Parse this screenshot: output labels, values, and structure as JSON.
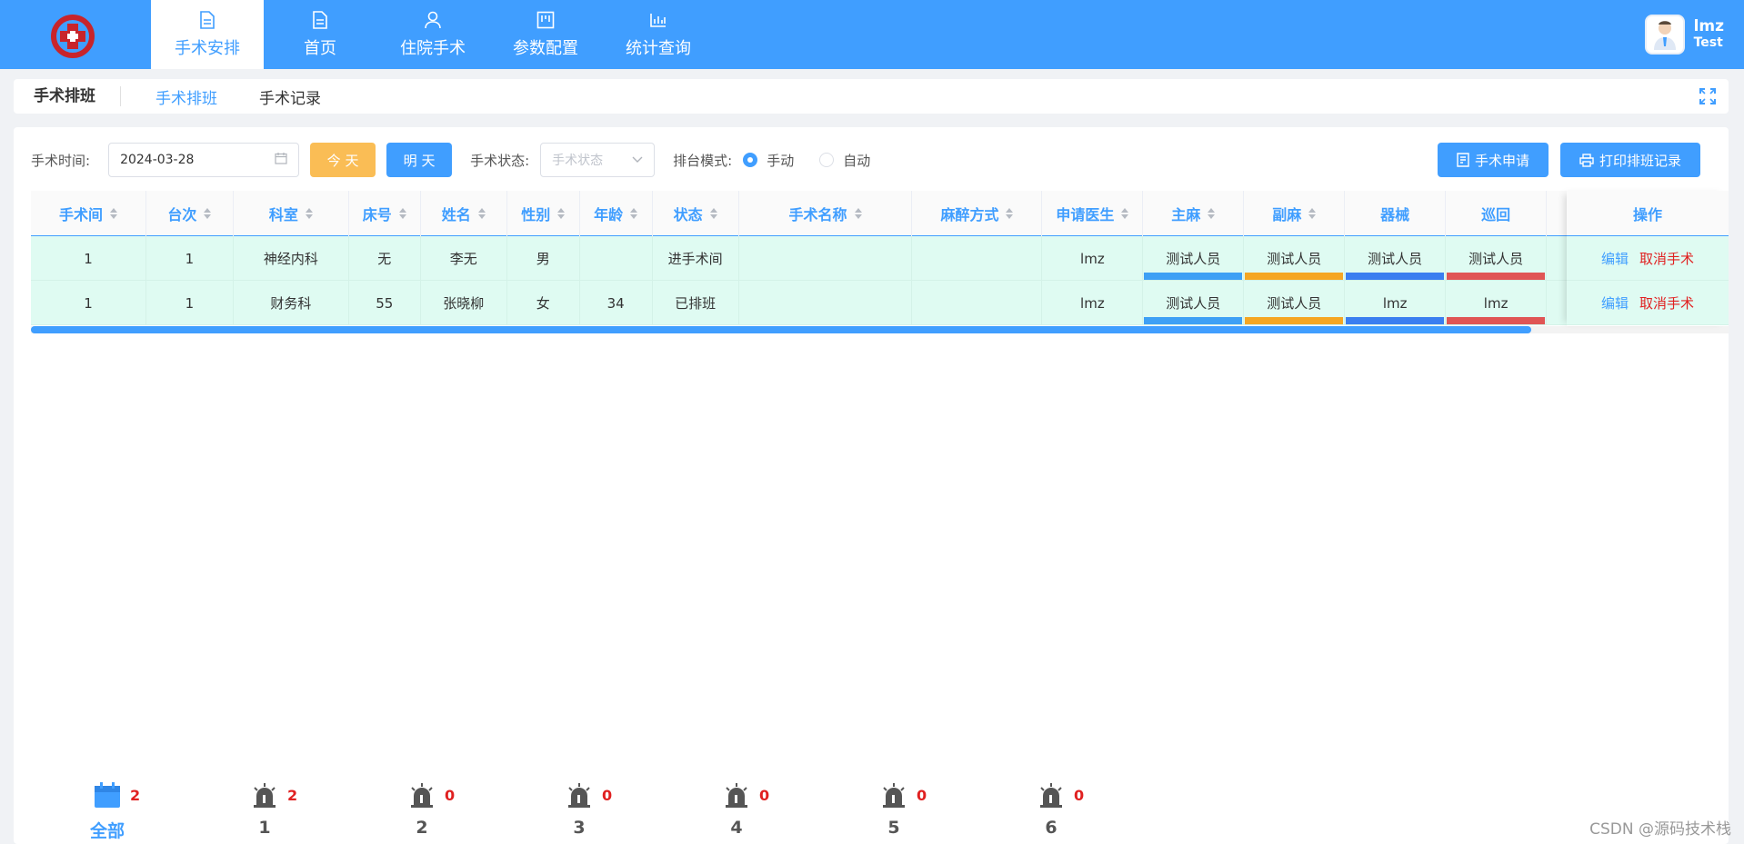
{
  "nav": {
    "items": [
      {
        "label": "手术安排",
        "icon": "document-icon"
      },
      {
        "label": "首页",
        "icon": "document-icon"
      },
      {
        "label": "住院手术",
        "icon": "user-icon"
      },
      {
        "label": "参数配置",
        "icon": "board-icon"
      },
      {
        "label": "统计查询",
        "icon": "bar-chart-icon"
      }
    ]
  },
  "user": {
    "name": "lmz",
    "sub": "Test"
  },
  "tabs": {
    "page_title": "手术排班",
    "items": [
      "手术排班",
      "手术记录"
    ]
  },
  "filters": {
    "date_label": "手术时间:",
    "date_value": "2024-03-28",
    "today": "今 天",
    "tomorrow": "明 天",
    "status_label": "手术状态:",
    "status_placeholder": "手术状态",
    "mode_label": "排台模式:",
    "mode_manual": "手动",
    "mode_auto": "自动",
    "apply": "手术申请",
    "print": "打印排班记录"
  },
  "table": {
    "columns": [
      "手术间",
      "台次",
      "科室",
      "床号",
      "姓名",
      "性别",
      "年龄",
      "状态",
      "手术名称",
      "麻醉方式",
      "申请医生",
      "主麻",
      "副麻",
      "器械",
      "巡回",
      "操作"
    ],
    "rows": [
      {
        "room": "1",
        "seq": "1",
        "dept": "神经内科",
        "bed": "无",
        "name": "李无",
        "sex": "男",
        "age": "",
        "status": "进手术间",
        "op_name": "",
        "anesthesia": "",
        "doctor": "lmz",
        "main_anes": "测试人员",
        "assist_anes": "测试人员",
        "instrument": "测试人员",
        "circulating": "测试人员"
      },
      {
        "room": "1",
        "seq": "1",
        "dept": "财务科",
        "bed": "55",
        "name": "张晓柳",
        "sex": "女",
        "age": "34",
        "status": "已排班",
        "op_name": "",
        "anesthesia": "",
        "doctor": "lmz",
        "main_anes": "测试人员",
        "assist_anes": "测试人员",
        "instrument": "lmz",
        "circulating": "lmz"
      }
    ],
    "actions": {
      "edit": "编辑",
      "cancel": "取消手术"
    }
  },
  "colors": {
    "primary": "#409eff",
    "orange": "#f5a623",
    "blue": "#3b82f6",
    "red": "#e05555",
    "row_bg": "#dffbf2"
  },
  "rooms": [
    {
      "label": "全部",
      "count": "2",
      "icon": "calendar-icon"
    },
    {
      "label": "1",
      "count": "2",
      "icon": "alarm-icon"
    },
    {
      "label": "2",
      "count": "0",
      "icon": "alarm-icon"
    },
    {
      "label": "3",
      "count": "0",
      "icon": "alarm-icon"
    },
    {
      "label": "4",
      "count": "0",
      "icon": "alarm-icon"
    },
    {
      "label": "5",
      "count": "0",
      "icon": "alarm-icon"
    },
    {
      "label": "6",
      "count": "0",
      "icon": "alarm-icon"
    }
  ],
  "watermark": "CSDN @源码技术栈"
}
